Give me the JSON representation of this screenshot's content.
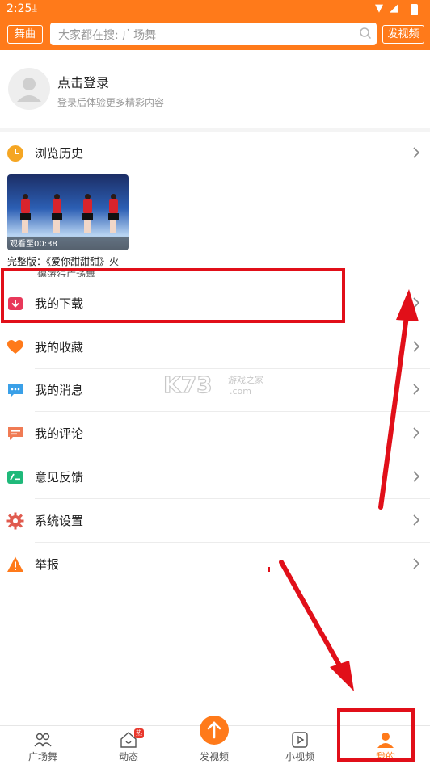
{
  "status_bar": {
    "time": "2:25"
  },
  "header": {
    "left_tag": "舞曲",
    "search_placeholder": "大家都在搜: 广场舞",
    "right_tag": "发视频"
  },
  "profile": {
    "title": "点击登录",
    "subtitle": "登录后体验更多精彩内容"
  },
  "history": {
    "label": "浏览历史",
    "items": [
      {
        "watched": "观看至00:38",
        "title": "完整版：《爱你甜甜甜》火",
        "title_line2": "爆流行广场舞"
      }
    ]
  },
  "menu": [
    {
      "id": "download",
      "label": "我的下载",
      "icon": "download-icon",
      "color": "#e8385a"
    },
    {
      "id": "favorites",
      "label": "我的收藏",
      "icon": "heart-icon",
      "color": "#ff7a1a"
    },
    {
      "id": "messages",
      "label": "我的消息",
      "icon": "message-icon",
      "color": "#3aa0e8"
    },
    {
      "id": "comments",
      "label": "我的评论",
      "icon": "comment-icon",
      "color": "#f07b54"
    },
    {
      "id": "feedback",
      "label": "意见反馈",
      "icon": "feedback-icon",
      "color": "#1fb97a"
    },
    {
      "id": "settings",
      "label": "系统设置",
      "icon": "gear-icon",
      "color": "#e05a4e"
    },
    {
      "id": "report",
      "label": "举报",
      "icon": "warning-icon",
      "color": "#ff7a1a"
    }
  ],
  "bottom_nav": [
    {
      "label": "广场舞",
      "icon": "people-icon"
    },
    {
      "label": "动态",
      "icon": "home-icon",
      "badge": "热"
    },
    {
      "label": "发视频",
      "icon": "upload-icon"
    },
    {
      "label": "小视频",
      "icon": "play-icon"
    },
    {
      "label": "我的",
      "icon": "user-icon",
      "active": true
    }
  ],
  "colors": {
    "accent": "#ff7a1a",
    "annotation": "#e10f19"
  }
}
